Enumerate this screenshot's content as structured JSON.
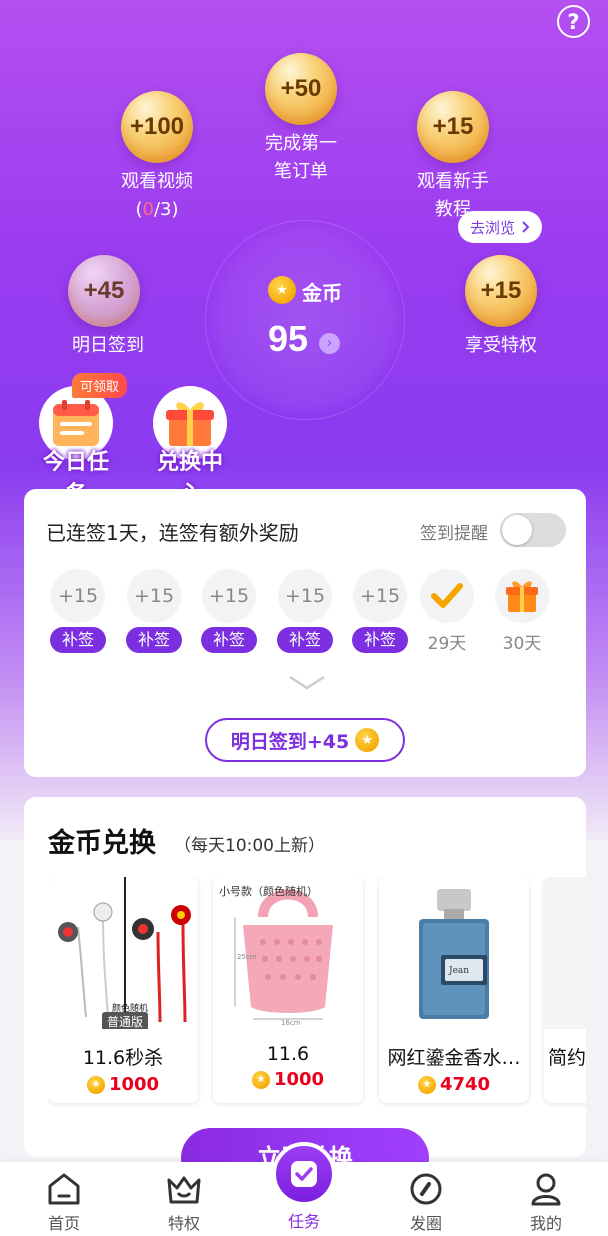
{
  "header": {
    "help_icon": "question-icon",
    "help_label": "?"
  },
  "tasks": [
    {
      "reward": "+100",
      "label_line1": "观看视频",
      "progress_open": "(",
      "progress_done": "0",
      "progress_total": "/3)"
    },
    {
      "reward": "+50",
      "label_line1": "完成第一",
      "label_line2": "笔订单"
    },
    {
      "reward": "+15",
      "label_line1": "观看新手",
      "label_line2": "教程"
    },
    {
      "reward": "+45",
      "label_line1": "明日签到"
    },
    {
      "reward": "+15",
      "label_line1": "享受特权",
      "action": "去浏览"
    }
  ],
  "balance": {
    "label": "金币",
    "value": "95"
  },
  "features": [
    {
      "label": "今日任务",
      "badge": "可领取",
      "icon": "calendar-icon"
    },
    {
      "label": "兑换中心",
      "icon": "gift-icon"
    }
  ],
  "signin": {
    "title": "已连签1天，连签有额外奖励",
    "remind_label": "签到提醒",
    "remind_enabled": false,
    "days": [
      {
        "reward": "+15",
        "action": "补签"
      },
      {
        "reward": "+15",
        "action": "补签"
      },
      {
        "reward": "+15",
        "action": "补签"
      },
      {
        "reward": "+15",
        "action": "补签"
      },
      {
        "reward": "+15",
        "action": "补签"
      },
      {
        "label": "29天",
        "icon": "check-icon"
      },
      {
        "label": "30天",
        "icon": "gift-icon"
      }
    ],
    "tomorrow_button": "明日签到+45"
  },
  "exchange": {
    "title": "金币兑换",
    "subtitle": "（每天10:00上新）",
    "products": [
      {
        "name": "11.6秒杀",
        "price": "1000",
        "image_tag": "普通版",
        "image_note": "颜色随机"
      },
      {
        "name": "11.6",
        "price": "1000",
        "image_note": "小号款（颜色随机）",
        "image_dim1": "25cm",
        "image_dim2": "16cm"
      },
      {
        "name": "网红鎏金香水…",
        "price": "4740"
      },
      {
        "name": "简约",
        "price": ""
      }
    ],
    "cta": "立即兑换"
  },
  "tabbar": {
    "items": [
      {
        "label": "首页",
        "icon": "home-icon"
      },
      {
        "label": "特权",
        "icon": "crown-icon"
      },
      {
        "label": "任务",
        "icon": "task-icon",
        "active": true
      },
      {
        "label": "发圈",
        "icon": "compass-icon"
      },
      {
        "label": "我的",
        "icon": "user-icon"
      }
    ]
  },
  "colors": {
    "primary": "#8a2be2",
    "accent": "#e8001c",
    "gold": "#f5a500"
  }
}
